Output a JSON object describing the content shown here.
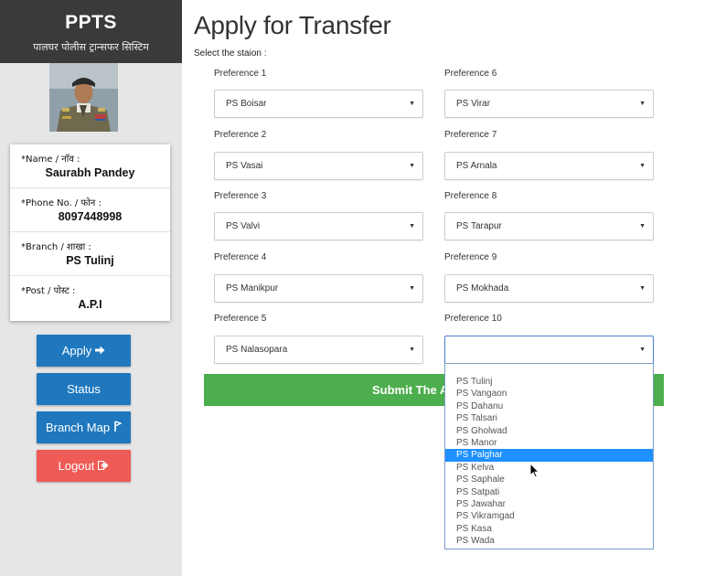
{
  "sidebar": {
    "brand_title": "PPTS",
    "brand_subtitle": "पालघर पोलीस ट्रान्सफर सिस्टिम",
    "profile": {
      "name_label": "*Name / नाॅव :",
      "name_value": "Saurabh Pandey",
      "phone_label": "*Phone No. / फोन :",
      "phone_value": "8097448998",
      "branch_label": "*Branch / शाखा :",
      "branch_value": "PS Tulinj",
      "post_label": "*Post / पोस्ट :",
      "post_value": "A.P.I"
    },
    "buttons": {
      "apply": "Apply",
      "status": "Status",
      "branch_map": "Branch Map",
      "logout": "Logout"
    }
  },
  "main": {
    "title": "Apply for Transfer",
    "select_station_label": "Select the staion :",
    "preferences": [
      {
        "label": "Preference 1",
        "value": "PS Boisar"
      },
      {
        "label": "Preference 2",
        "value": "PS Vasai"
      },
      {
        "label": "Preference 3",
        "value": "PS Valvi"
      },
      {
        "label": "Preference 4",
        "value": "PS Manikpur"
      },
      {
        "label": "Preference 5",
        "value": "PS Nalasopara"
      },
      {
        "label": "Preference 6",
        "value": "PS Virar"
      },
      {
        "label": "Preference 7",
        "value": "PS Arnala"
      },
      {
        "label": "Preference 8",
        "value": "PS Tarapur"
      },
      {
        "label": "Preference 9",
        "value": "PS Mokhada"
      },
      {
        "label": "Preference 10",
        "value": ""
      }
    ],
    "submit_label": "Submit The Application",
    "dropdown_options": [
      "PS Tulinj",
      "PS Vangaon",
      "PS Dahanu",
      "PS Talsari",
      "PS Gholwad",
      "PS Manor",
      "PS Palghar",
      "PS Kelva",
      "PS Saphale",
      "PS Satpati",
      "PS Jawahar",
      "PS Vikramgad",
      "PS Kasa",
      "PS Wada"
    ],
    "dropdown_highlighted": "PS Palghar"
  },
  "colors": {
    "sidebar_bg": "#e6e6e6",
    "brand_bg": "#3a3a3a",
    "primary_blue": "#1f78be",
    "danger_red": "#ef5b56",
    "submit_green": "#4cae4c",
    "highlight_blue": "#1e90ff"
  },
  "icons": {
    "apply": "arrow-right-icon",
    "branch_map": "map-marker-icon",
    "logout": "sign-out-icon",
    "select": "caret-down-icon"
  }
}
